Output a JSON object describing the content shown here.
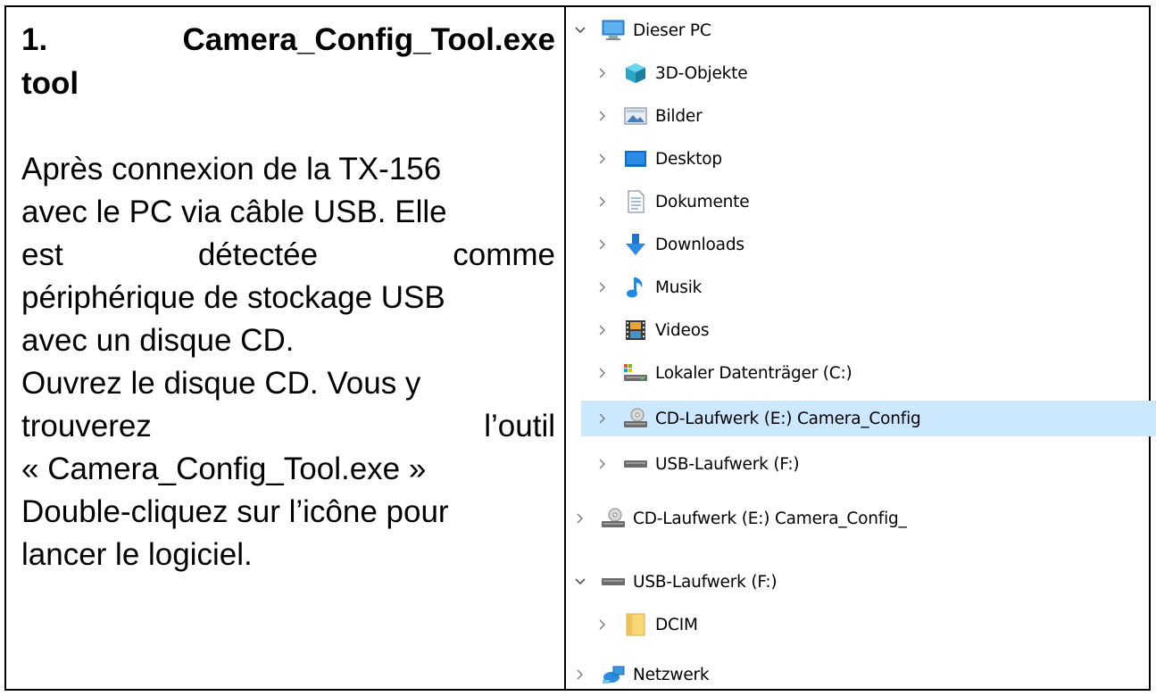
{
  "left_panel": {
    "heading_number": "1.",
    "heading_name": "Camera_Config_Tool.exe",
    "heading_suffix": "tool",
    "para1_lines": [
      "Après connexion de la TX-156",
      "avec le PC via câble USB. Elle",
      [
        "est",
        "détectée",
        "comme"
      ],
      "périphérique de stockage USB",
      "avec un disque CD."
    ],
    "para2_lines": [
      "Ouvrez le disque CD. Vous y",
      [
        "trouverez",
        "l’outil"
      ],
      "« Camera_Config_Tool.exe »",
      "Double-cliquez sur l’icône pour",
      "lancer le logiciel."
    ]
  },
  "tree": {
    "this_pc": "Dieser PC",
    "items": [
      {
        "label": "3D-Objekte",
        "icon": "3d-objects-icon"
      },
      {
        "label": "Bilder",
        "icon": "pictures-icon"
      },
      {
        "label": "Desktop",
        "icon": "desktop-icon"
      },
      {
        "label": "Dokumente",
        "icon": "documents-icon"
      },
      {
        "label": "Downloads",
        "icon": "downloads-icon"
      },
      {
        "label": "Musik",
        "icon": "music-icon"
      },
      {
        "label": "Videos",
        "icon": "videos-icon"
      },
      {
        "label": "Lokaler Datenträger (C:)",
        "icon": "local-disk-icon"
      },
      {
        "label": "CD-Laufwerk (E:) Camera_Config",
        "icon": "cd-drive-icon"
      },
      {
        "label": "USB-Laufwerk (F:)",
        "icon": "usb-drive-icon"
      }
    ],
    "cd_drive_root": "CD-Laufwerk (E:) Camera_Config_",
    "usb_drive_root": "USB-Laufwerk (F:)",
    "dcim": "DCIM",
    "network": "Netzwerk",
    "selected_color": "#cce8ff"
  }
}
